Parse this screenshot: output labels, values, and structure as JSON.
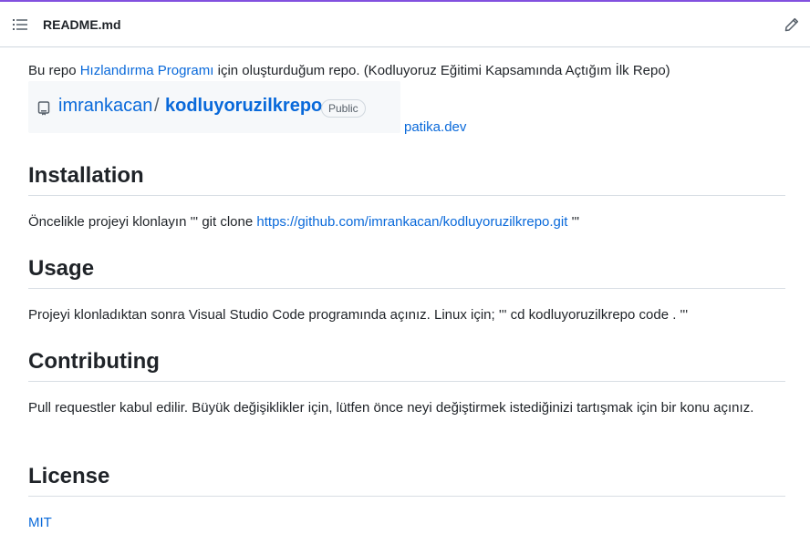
{
  "header": {
    "file_name": "README.md"
  },
  "intro": {
    "before": "Bu repo ",
    "link": "Hızlandırma Programı",
    "after": " için oluşturduğum repo. (Kodluyoruz Eğitimi Kapsamında Açtığım İlk Repo)"
  },
  "repo_card": {
    "owner": "imrankacan",
    "separator": "/",
    "name": "kodluyoruzilkrepo",
    "visibility": "Public"
  },
  "patika_link": "patika.dev",
  "sections": {
    "installation": {
      "heading": "Installation",
      "text_before": "Öncelikle projeyi klonlayın ''' git clone ",
      "link": "https://github.com/imrankacan/kodluyoruzilkrepo.git",
      "text_after": " '''"
    },
    "usage": {
      "heading": "Usage",
      "text": "Projeyi klonladıktan sonra Visual Studio Code programında açınız. Linux için; ''' cd kodluyoruzilkrepo code . '''"
    },
    "contributing": {
      "heading": "Contributing",
      "text": "Pull requestler kabul edilir. Büyük değişiklikler için, lütfen önce neyi değiştirmek istediğinizi tartışmak için bir konu açınız."
    },
    "license": {
      "heading": "License",
      "link": "MIT"
    }
  },
  "colors": {
    "accent": "#8250df",
    "link": "#0969da",
    "text": "#1f2328",
    "border": "#d0d7de"
  },
  "icons": [
    "list-icon",
    "pencil-icon",
    "repo-icon"
  ]
}
